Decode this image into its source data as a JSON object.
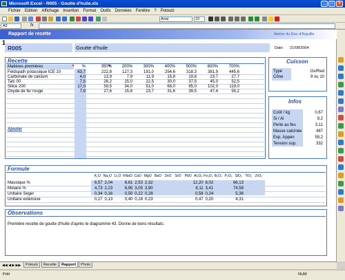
{
  "window": {
    "title": "Microsoft Excel - R005 - Goutte d'huile.xls",
    "min": "_",
    "max": "□",
    "close": "×"
  },
  "menu": [
    "Fichier",
    "Edition",
    "Affichage",
    "Insertion",
    "Format",
    "Outils",
    "Données",
    "Fenêtre",
    "?",
    "Potoulz"
  ],
  "toolbar": {
    "font": "Arial",
    "size": "10"
  },
  "formula": {
    "namebox": "A2",
    "fx": "fx"
  },
  "header": {
    "title": "Rapport de recette",
    "atelier": "Atelier du Roc d'Arguille",
    "ref": "R005",
    "name": "Goutte d'huile",
    "date_label": "Date:",
    "date": "21/08/2004",
    "corner_mark": "1"
  },
  "recette": {
    "title": "Recette",
    "cols": [
      "Matières premières",
      "%",
      "350%",
      "200%",
      "300%",
      "400%",
      "500%",
      "600%",
      "700%"
    ],
    "rows": [
      [
        "Feldspath potassique ICE 10",
        "63,7",
        "222,8",
        "127,3",
        "191,0",
        "254,6",
        "318,3",
        "381,9",
        "445,6"
      ],
      [
        "Carbonate de calcium",
        "4,0",
        "13,9",
        "7,9",
        "11,9",
        "15,8",
        "19,8",
        "23,7",
        "27,7"
      ],
      [
        "Talc 00",
        "7,5",
        "26,2",
        "15,0",
        "22,5",
        "30,0",
        "37,5",
        "45,0",
        "52,5"
      ],
      [
        "Silice 200",
        "17,0",
        "59,5",
        "34,0",
        "51,0",
        "68,0",
        "85,0",
        "102,0",
        "119,0"
      ],
      [
        "Oxyde de fer rouge",
        "7,9",
        "27,6",
        "15,8",
        "23,7",
        "31,6",
        "39,5",
        "47,4",
        "55,2"
      ]
    ],
    "ajouter": "Ajouter"
  },
  "cuisson": {
    "title": "Cuisson",
    "rows": [
      [
        "Type",
        "Ox/Red"
      ],
      [
        "Cône",
        "9 ou 10"
      ]
    ]
  },
  "infos": {
    "title": "Infos",
    "rows": [
      [
        "Coût / kg",
        "0,67"
      ],
      [
        "Si / Al",
        "9,2"
      ],
      [
        "Perte au feu",
        "3,11"
      ],
      [
        "Masse calcinée",
        "487"
      ],
      [
        "Exp. Appen",
        "59,2"
      ],
      [
        "Tension sup.",
        "332"
      ]
    ]
  },
  "formule": {
    "title": "Formule",
    "oxides": [
      "K₂O",
      "Na₂O",
      "Li₂O",
      "KNaO",
      "CaO",
      "MgO",
      "BaO",
      "ZnO",
      "SrO",
      "PbO",
      "Al₂O₃",
      "Fe₂O₃",
      "B₂O₃",
      "P₂O₅",
      "SiO₂",
      "TiO₂",
      "ZrO₂"
    ],
    "rows": [
      {
        "label": "Massique %",
        "vals": [
          "6,57",
          "2,04",
          "",
          "8,61",
          "2,53",
          "2,32",
          "",
          "",
          "",
          "",
          "12,20",
          "8,02",
          "",
          "",
          "66,13",
          "",
          ""
        ]
      },
      {
        "label": "Molaire %",
        "vals": [
          "4,73",
          "2,23",
          "",
          "6,95",
          "3,05",
          "3,90",
          "",
          "",
          "",
          "",
          "8,11",
          "3,41",
          "",
          "",
          "74,58",
          "",
          ""
        ]
      },
      {
        "label": "Unitaire Seger",
        "vals": [
          "0,34",
          "0,16",
          "",
          "0,50",
          "0,22",
          "0,28",
          "",
          "",
          "",
          "",
          "0,58",
          "0,24",
          "",
          "",
          "5,36",
          "",
          ""
        ]
      },
      {
        "label": "Unitaire extensive",
        "vals": [
          "0,27",
          "0,13",
          "",
          "0,40",
          "0,18",
          "0,23",
          "",
          "",
          "",
          "",
          "0,47",
          "0,20",
          "",
          "",
          "4,31",
          "",
          ""
        ]
      }
    ]
  },
  "observations": {
    "title": "Observations",
    "text": "Première recette de goutte d'huile d'après le diagramme 43. Donne de bons résultats."
  },
  "tabs": [
    "Potoulz",
    "Recette",
    "Rapport",
    "Photo"
  ],
  "status": {
    "left": "Prêt",
    "num": "NUM"
  },
  "colors": {
    "accent": "#2a4fa8",
    "fill": "#c7d6f2"
  }
}
